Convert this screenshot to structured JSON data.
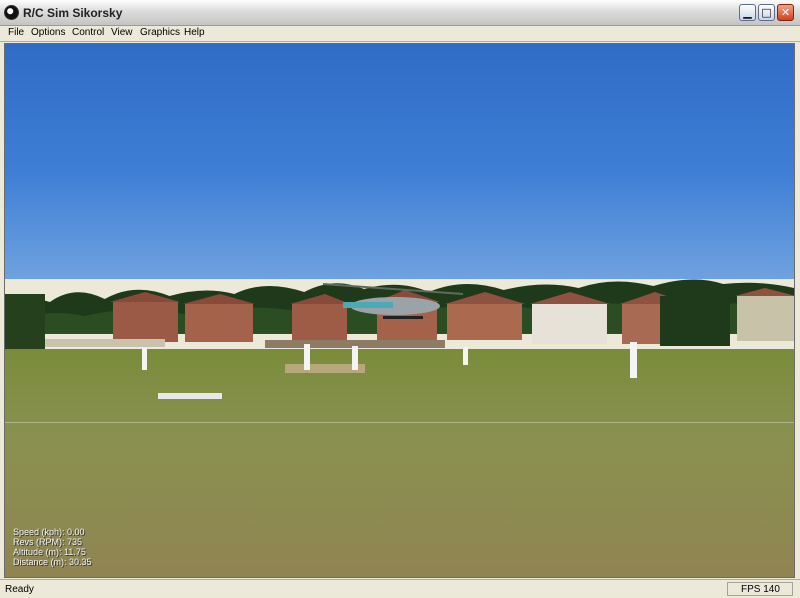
{
  "window": {
    "title": "R/C Sim Sikorsky"
  },
  "menu": {
    "items": [
      "File",
      "Options",
      "Control",
      "View",
      "Graphics",
      "Help"
    ]
  },
  "hud": {
    "speed": "Speed (kph): 0.00",
    "revs": "Revs (RPM): 735",
    "altitude": "Altitude (m): 11.75",
    "distance": "Distance (m): 30.35"
  },
  "status": {
    "text": "Ready",
    "fps": "FPS 140"
  }
}
